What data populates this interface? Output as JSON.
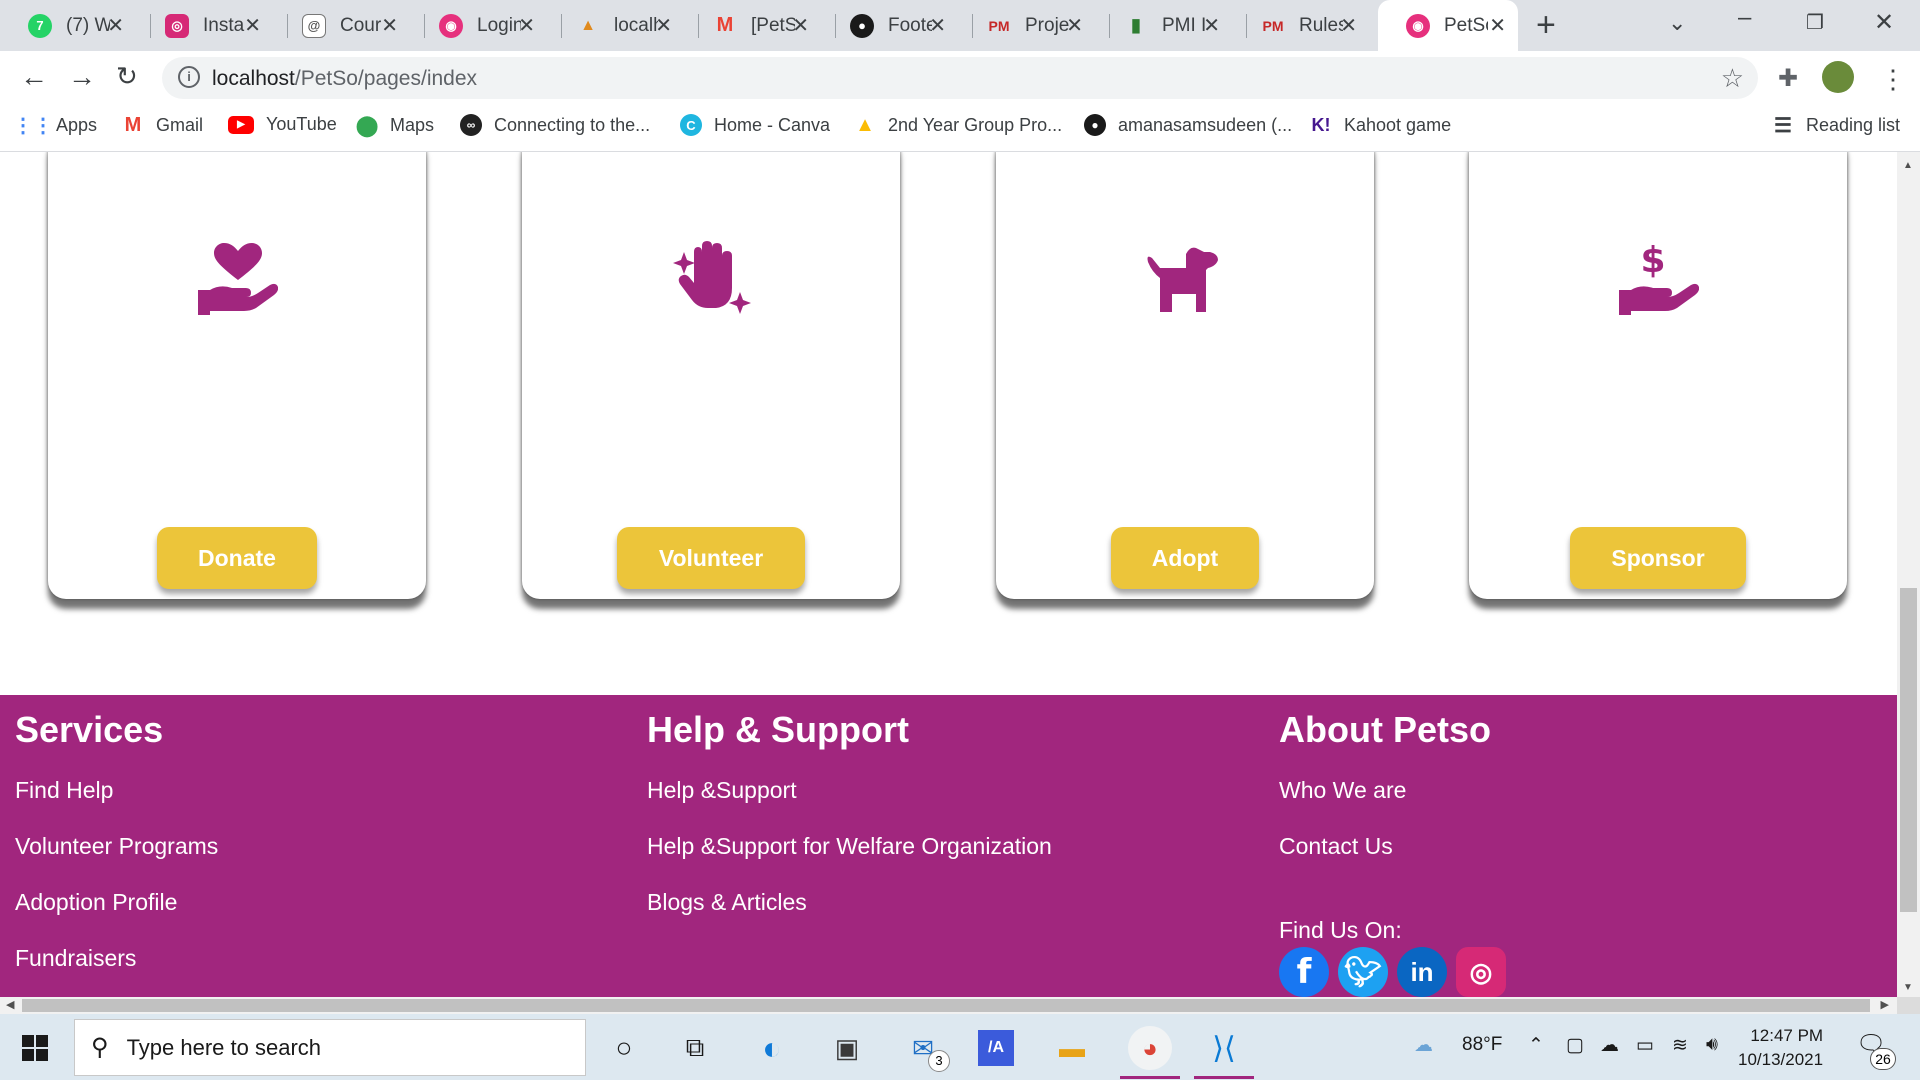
{
  "browser": {
    "tabs": [
      {
        "title": "(7) W",
        "icon": "whatsapp-icon",
        "color": "#25d366"
      },
      {
        "title": "Insta",
        "icon": "instagram-icon",
        "color": "#d62976"
      },
      {
        "title": "Cour",
        "icon": "course-icon",
        "color": "#555555"
      },
      {
        "title": "Login",
        "icon": "petso-icon",
        "color": "#e6307d"
      },
      {
        "title": "localh",
        "icon": "pma-icon",
        "color": "#e08a1e"
      },
      {
        "title": "[PetS",
        "icon": "gmail-icon",
        "color": "#ea4335"
      },
      {
        "title": "Foote",
        "icon": "github-icon",
        "color": "#1a1a1a"
      },
      {
        "title": "Proje",
        "icon": "pm-icon",
        "color": "#c62828"
      },
      {
        "title": "PMI I",
        "icon": "chart-icon",
        "color": "#2e7d32"
      },
      {
        "title": "Rules",
        "icon": "pm-icon",
        "color": "#c62828"
      },
      {
        "title": "PetSo",
        "icon": "petso-icon",
        "color": "#e6307d",
        "active": true
      }
    ],
    "url_host": "localhost",
    "url_path": "/PetSo/pages/index",
    "bookmarks": [
      {
        "label": "Apps",
        "icon": "apps-grid-icon"
      },
      {
        "label": "Gmail",
        "icon": "gmail-icon"
      },
      {
        "label": "YouTube",
        "icon": "youtube-icon"
      },
      {
        "label": "Maps",
        "icon": "maps-pin-icon"
      },
      {
        "label": "Connecting to the...",
        "icon": "link-icon"
      },
      {
        "label": "Home - Canva",
        "icon": "canva-icon"
      },
      {
        "label": "2nd Year Group Pro...",
        "icon": "drive-icon"
      },
      {
        "label": "amanasamsudeen (...",
        "icon": "github-icon"
      },
      {
        "label": "Kahoot game",
        "icon": "kahoot-icon"
      }
    ],
    "reading_list": "Reading list"
  },
  "cards": [
    {
      "button": "Donate",
      "icon": "heart-hand-icon"
    },
    {
      "button": "Volunteer",
      "icon": "raised-hand-sparkle-icon"
    },
    {
      "button": "Adopt",
      "icon": "dog-icon"
    },
    {
      "button": "Sponsor",
      "icon": "dollar-hand-icon"
    }
  ],
  "footer": {
    "services": {
      "heading": "Services",
      "links": [
        "Find Help",
        "Volunteer Programs",
        "Adoption Profile",
        "Fundraisers"
      ]
    },
    "help": {
      "heading": "Help & Support",
      "links": [
        "Help &Support",
        "Help &Support for Welfare Organization",
        "Blogs & Articles"
      ]
    },
    "about": {
      "heading": "About Petso",
      "links": [
        "Who We are",
        "Contact Us"
      ],
      "find_us": "Find Us On:",
      "social": [
        {
          "label": "f",
          "icon": "facebook-icon",
          "color": "#1877f2"
        },
        {
          "label": "t",
          "icon": "twitter-icon",
          "color": "#1da1f2"
        },
        {
          "label": "in",
          "icon": "linkedin-icon",
          "color": "#0a66c2"
        },
        {
          "label": "ig",
          "icon": "instagram-icon",
          "color": "#d62976"
        }
      ]
    }
  },
  "colors": {
    "brand": "#a1267e",
    "button": "#ecc53a"
  },
  "taskbar": {
    "search_placeholder": "Type here to search",
    "mail_badge": "3",
    "weather": "88°F",
    "time": "12:47 PM",
    "date": "10/13/2021",
    "notifications": "26"
  }
}
